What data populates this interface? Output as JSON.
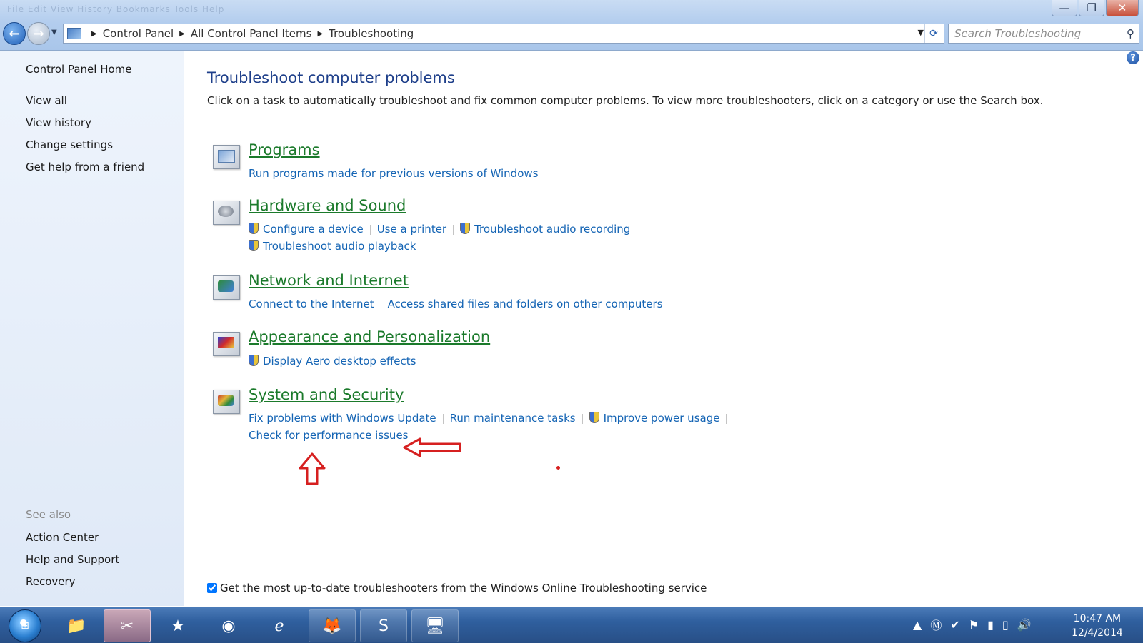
{
  "window": {
    "menu_ghost": "File  Edit  View  History  Bookmarks  Tools  Help",
    "minimize_glyph": "—",
    "restore_glyph": "❐",
    "close_glyph": "✕"
  },
  "address": {
    "crumbs": [
      "Control Panel",
      "All Control Panel Items",
      "Troubleshooting"
    ]
  },
  "search": {
    "placeholder": "Search Troubleshooting"
  },
  "sidebar": {
    "home": "Control Panel Home",
    "items": [
      "View all",
      "View history",
      "Change settings",
      "Get help from a friend"
    ],
    "see_also_heading": "See also",
    "see_also": [
      "Action Center",
      "Help and Support",
      "Recovery"
    ]
  },
  "main": {
    "title": "Troubleshoot computer problems",
    "description": "Click on a task to automatically troubleshoot and fix common computer problems. To view more troubleshooters, click on a category or use the Search box.",
    "categories": [
      {
        "title": "Programs",
        "icon": "programs-icon",
        "links": [
          "Run programs made for previous versions of Windows"
        ]
      },
      {
        "title": "Hardware and Sound",
        "icon": "hardware-sound-icon",
        "links": [
          "Configure a device",
          "Use a printer",
          "Troubleshoot audio recording",
          "Troubleshoot audio playback"
        ]
      },
      {
        "title": "Network and Internet",
        "icon": "network-icon",
        "links": [
          "Connect to the Internet",
          "Access shared files and folders on other computers"
        ]
      },
      {
        "title": "Appearance and Personalization",
        "icon": "appearance-icon",
        "links": [
          "Display Aero desktop effects"
        ]
      },
      {
        "title": "System and Security",
        "icon": "system-security-icon",
        "links": [
          "Fix problems with Windows Update",
          "Run maintenance tasks",
          "Improve power usage",
          "Check for performance issues"
        ]
      }
    ],
    "online_checkbox": {
      "label": "Get the most up-to-date troubleshooters from the Windows Online Troubleshooting service",
      "checked": true
    }
  },
  "taskbar": {
    "items": [
      "file-explorer-icon",
      "snipping-tool-icon",
      "pokerstars-icon",
      "chrome-icon",
      "internet-explorer-icon",
      "firefox-icon",
      "skype-icon",
      "control-panel-icon"
    ],
    "skype_glyph": "S",
    "clock_time": "10:47 AM",
    "clock_date": "12/4/2014"
  },
  "colors": {
    "link": "#1464b4",
    "category_title": "#1b7a2b",
    "page_title": "#1e3f8a",
    "annotation": "#d62020"
  }
}
